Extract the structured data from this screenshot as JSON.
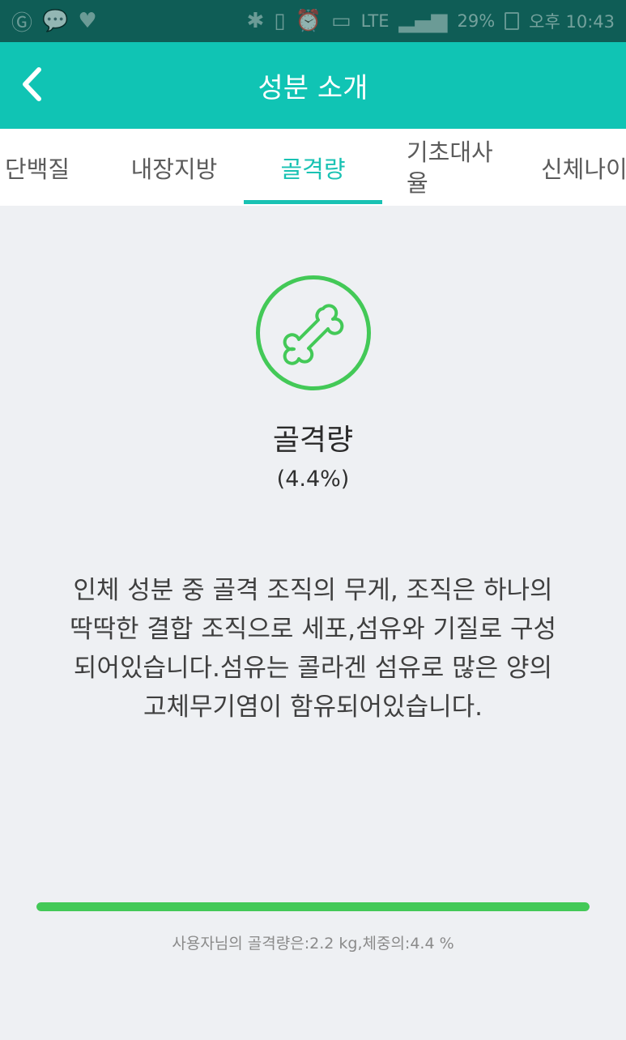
{
  "status_bar": {
    "left_icons": [
      "g-app-icon",
      "talk-icon",
      "heart-icon"
    ],
    "right_icons": [
      "bluetooth-icon",
      "vibrate-icon",
      "alarm-icon",
      "hd-icon"
    ],
    "network": "LTE",
    "battery": "29%",
    "time": "오후 10:43"
  },
  "app_bar": {
    "title": "성분 소개",
    "back_icon": "chevron-left-icon"
  },
  "tabs": {
    "items": [
      {
        "label": "단백질"
      },
      {
        "label": "내장지방"
      },
      {
        "label": "골격량"
      },
      {
        "label": "기초대사율"
      },
      {
        "label": "신체나이"
      }
    ],
    "active_index": 2
  },
  "metric": {
    "icon": "bone-icon",
    "name": "골격량",
    "value": "(4.4%)"
  },
  "description": "인체 성분 중 골격 조직의 무게, 조직은 하나의 딱딱한 결합 조직으로 세포,섬유와 기질로 구성되어있습니다.섬유는 콜라겐 섬유로 많은 양의 고체무기염이 함유되어있습니다.",
  "progress": {
    "fraction": 1.0
  },
  "summary": "사용자님의 골격량은:2.2 kg,체중의:4.4 %",
  "colors": {
    "status_bar": "#0f5d56",
    "app_bar": "#10c4b4",
    "accent": "#19c2b3",
    "green": "#43c957",
    "background": "#eef0f3"
  }
}
